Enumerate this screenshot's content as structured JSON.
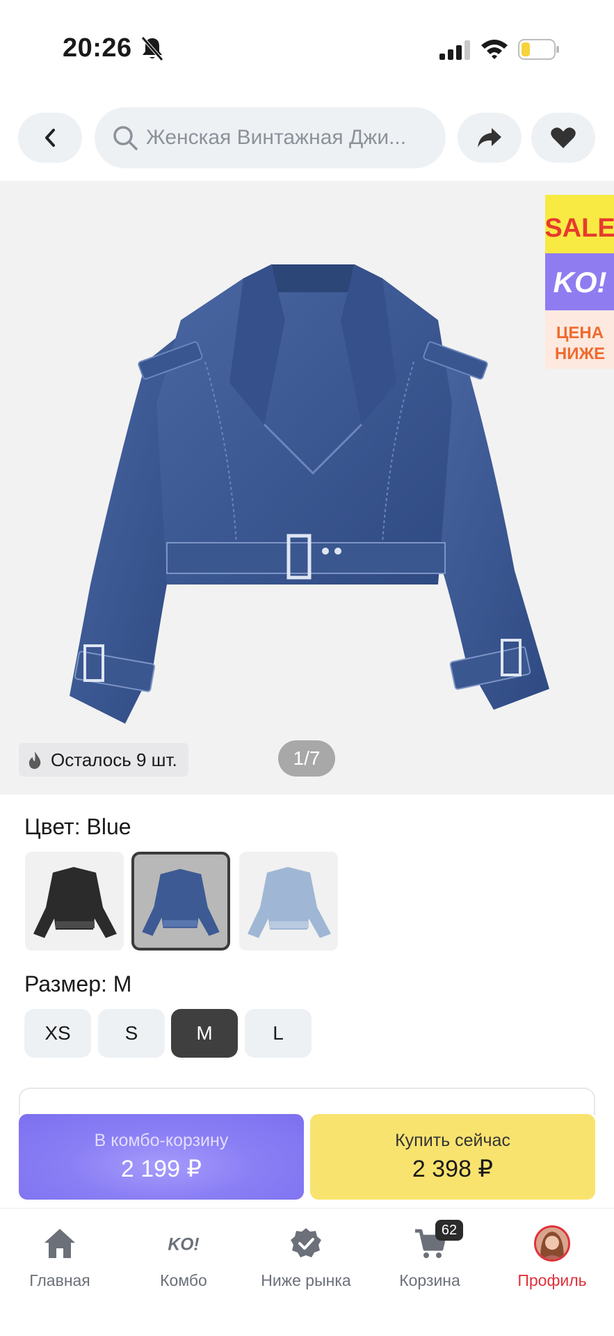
{
  "status_bar": {
    "time": "20:26"
  },
  "header": {
    "search_text": "Женская Винтажная Джи..."
  },
  "gallery": {
    "promo_sale": "SALE",
    "promo_brand": "KO!",
    "promo_line1": "ЦЕНА",
    "promo_line2": "НИЖЕ",
    "stock_text": "Осталось 9 шт.",
    "page_counter": "1/7"
  },
  "color": {
    "title": "Цвет: Blue",
    "swatches": [
      "black",
      "blue",
      "light-blue"
    ],
    "selected_index": 1
  },
  "size": {
    "title": "Размер: M",
    "options": [
      "XS",
      "S",
      "M",
      "L"
    ],
    "selected": "M"
  },
  "actions": {
    "combo_label": "В комбо-корзину",
    "combo_price": "2 199 ₽",
    "buy_label": "Купить сейчас",
    "buy_price": "2 398 ₽"
  },
  "tabbar": {
    "items": [
      {
        "label": "Главная",
        "icon": "home-icon"
      },
      {
        "label": "Комбо",
        "icon": "ko-logo-icon"
      },
      {
        "label": "Ниже рынка",
        "icon": "check-badge-icon"
      },
      {
        "label": "Корзина",
        "icon": "cart-icon",
        "badge": "62"
      },
      {
        "label": "Профиль",
        "icon": "avatar",
        "active": true
      }
    ]
  },
  "colors": {
    "accent_red": "#e0313b",
    "combo_purple": "#8b7ff5",
    "buy_yellow": "#f9e36f",
    "denim": "#3d5a94"
  }
}
